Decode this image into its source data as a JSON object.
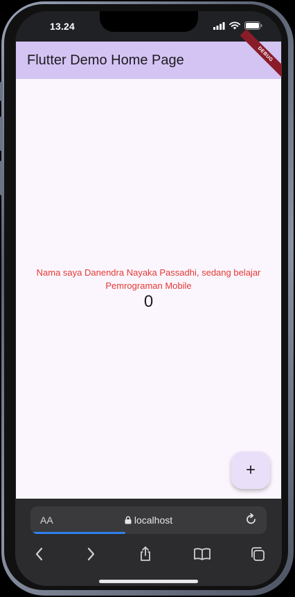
{
  "status_bar": {
    "time": "13.24"
  },
  "app": {
    "title": "Flutter Demo Home Page",
    "debug_banner": "DEBUG",
    "message": "Nama saya Danendra Nayaka Passadhi, sedang belajar Pemrograman Mobile",
    "counter": "0",
    "fab_label": "+",
    "colors": {
      "appbar": "#d3c4f3",
      "background": "#fbf6fd",
      "message": "#e53935",
      "fab": "#eadff9"
    }
  },
  "browser": {
    "text_size_label": "AA",
    "url": "localhost",
    "load_progress": 0.4,
    "toolbar": [
      "back-icon",
      "forward-icon",
      "share-icon",
      "bookmarks-icon",
      "tabs-icon"
    ]
  }
}
